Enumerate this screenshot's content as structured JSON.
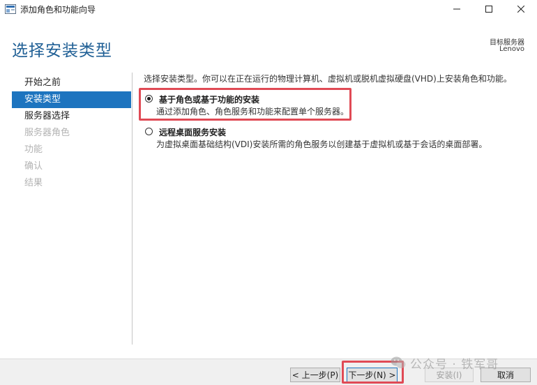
{
  "window": {
    "title": "添加角色和功能向导",
    "controls": {
      "minimize": "minimize-icon",
      "maximize": "maximize-icon",
      "close": "close-icon"
    }
  },
  "header": {
    "page_title": "选择安装类型",
    "target_label": "目标服务器",
    "target_value": "Lenovo"
  },
  "sidebar": {
    "items": [
      {
        "label": "开始之前",
        "state": "normal"
      },
      {
        "label": "安装类型",
        "state": "active"
      },
      {
        "label": "服务器选择",
        "state": "normal"
      },
      {
        "label": "服务器角色",
        "state": "disabled"
      },
      {
        "label": "功能",
        "state": "disabled"
      },
      {
        "label": "确认",
        "state": "disabled"
      },
      {
        "label": "结果",
        "state": "disabled"
      }
    ]
  },
  "content": {
    "intro": "选择安装类型。你可以在正在运行的物理计算机、虚拟机或脱机虚拟硬盘(VHD)上安装角色和功能。",
    "options": [
      {
        "title": "基于角色或基于功能的安装",
        "description": "通过添加角色、角色服务和功能来配置单个服务器。",
        "selected": true
      },
      {
        "title": "远程桌面服务安装",
        "description": "为虚拟桌面基础结构(VDI)安装所需的角色服务以创建基于虚拟机或基于会话的桌面部署。",
        "selected": false
      }
    ]
  },
  "footer": {
    "prev_label": "< 上一步(P)",
    "next_label": "下一步(N) >",
    "install_label": "安装(I)",
    "cancel_label": "取消"
  },
  "watermark": {
    "text": "公众号 · 铁军哥",
    "icon": "wechat-icon"
  },
  "colors": {
    "accent": "#1d74bf",
    "title": "#1f5f95",
    "highlight": "#e04a55"
  }
}
